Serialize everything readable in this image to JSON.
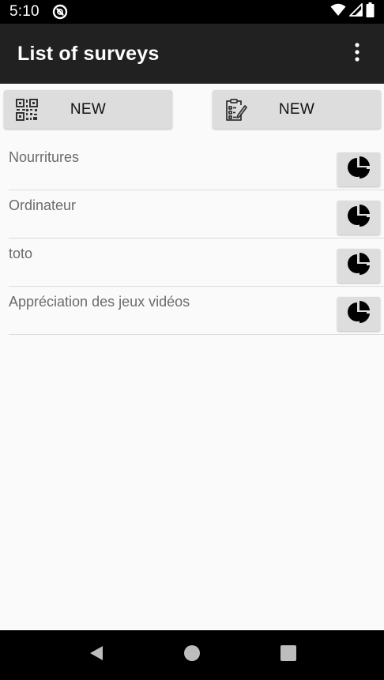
{
  "status_bar": {
    "time": "5:10",
    "icons": [
      "app-notification-icon",
      "wifi-icon",
      "signal-icon",
      "battery-icon"
    ]
  },
  "app_bar": {
    "title": "List of surveys",
    "menu_icon": "more-vert-icon"
  },
  "actions": {
    "scan_new": {
      "label": "NEW",
      "icon": "qr-code-icon"
    },
    "create_new": {
      "label": "NEW",
      "icon": "clipboard-edit-icon"
    }
  },
  "surveys": [
    {
      "name": "Nourritures",
      "action_icon": "pie-chart-icon"
    },
    {
      "name": "Ordinateur",
      "action_icon": "pie-chart-icon"
    },
    {
      "name": "toto",
      "action_icon": "pie-chart-icon"
    },
    {
      "name": "Appréciation des jeux vidéos",
      "action_icon": "pie-chart-icon"
    }
  ],
  "nav_bar": {
    "icons": [
      "back-icon",
      "home-icon",
      "recents-icon"
    ]
  },
  "colors": {
    "status_bar": "#000000",
    "app_bar": "#212121",
    "background": "#fafafa",
    "button": "#dddddd",
    "item_text": "#6b6b6b",
    "divider": "#dcdcdc"
  }
}
